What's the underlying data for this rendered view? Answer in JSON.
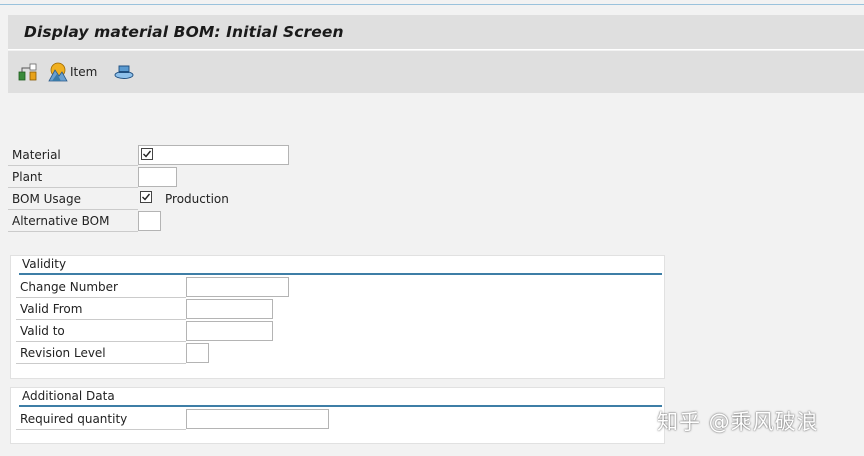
{
  "screen": {
    "title": "Display material BOM: Initial Screen"
  },
  "toolbar": {
    "buttons": [
      {
        "icon": "hierarchy-icon",
        "label": ""
      },
      {
        "icon": "item-icon",
        "label": "Item"
      },
      {
        "icon": "hat-icon",
        "label": ""
      }
    ]
  },
  "form": {
    "material": {
      "label": "Material",
      "value": "",
      "checked": true
    },
    "plant": {
      "label": "Plant",
      "value": ""
    },
    "bom_usage": {
      "label": "BOM Usage",
      "checked": true,
      "description": "Production"
    },
    "alternative_bom": {
      "label": "Alternative BOM",
      "value": ""
    }
  },
  "validity": {
    "title": "Validity",
    "change_number": {
      "label": "Change Number",
      "value": ""
    },
    "valid_from": {
      "label": "Valid From",
      "value": ""
    },
    "valid_to": {
      "label": "Valid to",
      "value": ""
    },
    "revision_level": {
      "label": "Revision Level",
      "value": ""
    }
  },
  "additional_data": {
    "title": "Additional Data",
    "required_quantity": {
      "label": "Required quantity",
      "value": ""
    }
  },
  "watermark": {
    "text": "知乎 @乘风破浪"
  },
  "colors": {
    "accent": "#3e7ea6",
    "titlebar_bg": "#dfdfdf",
    "page_bg": "#f2f2f2"
  }
}
